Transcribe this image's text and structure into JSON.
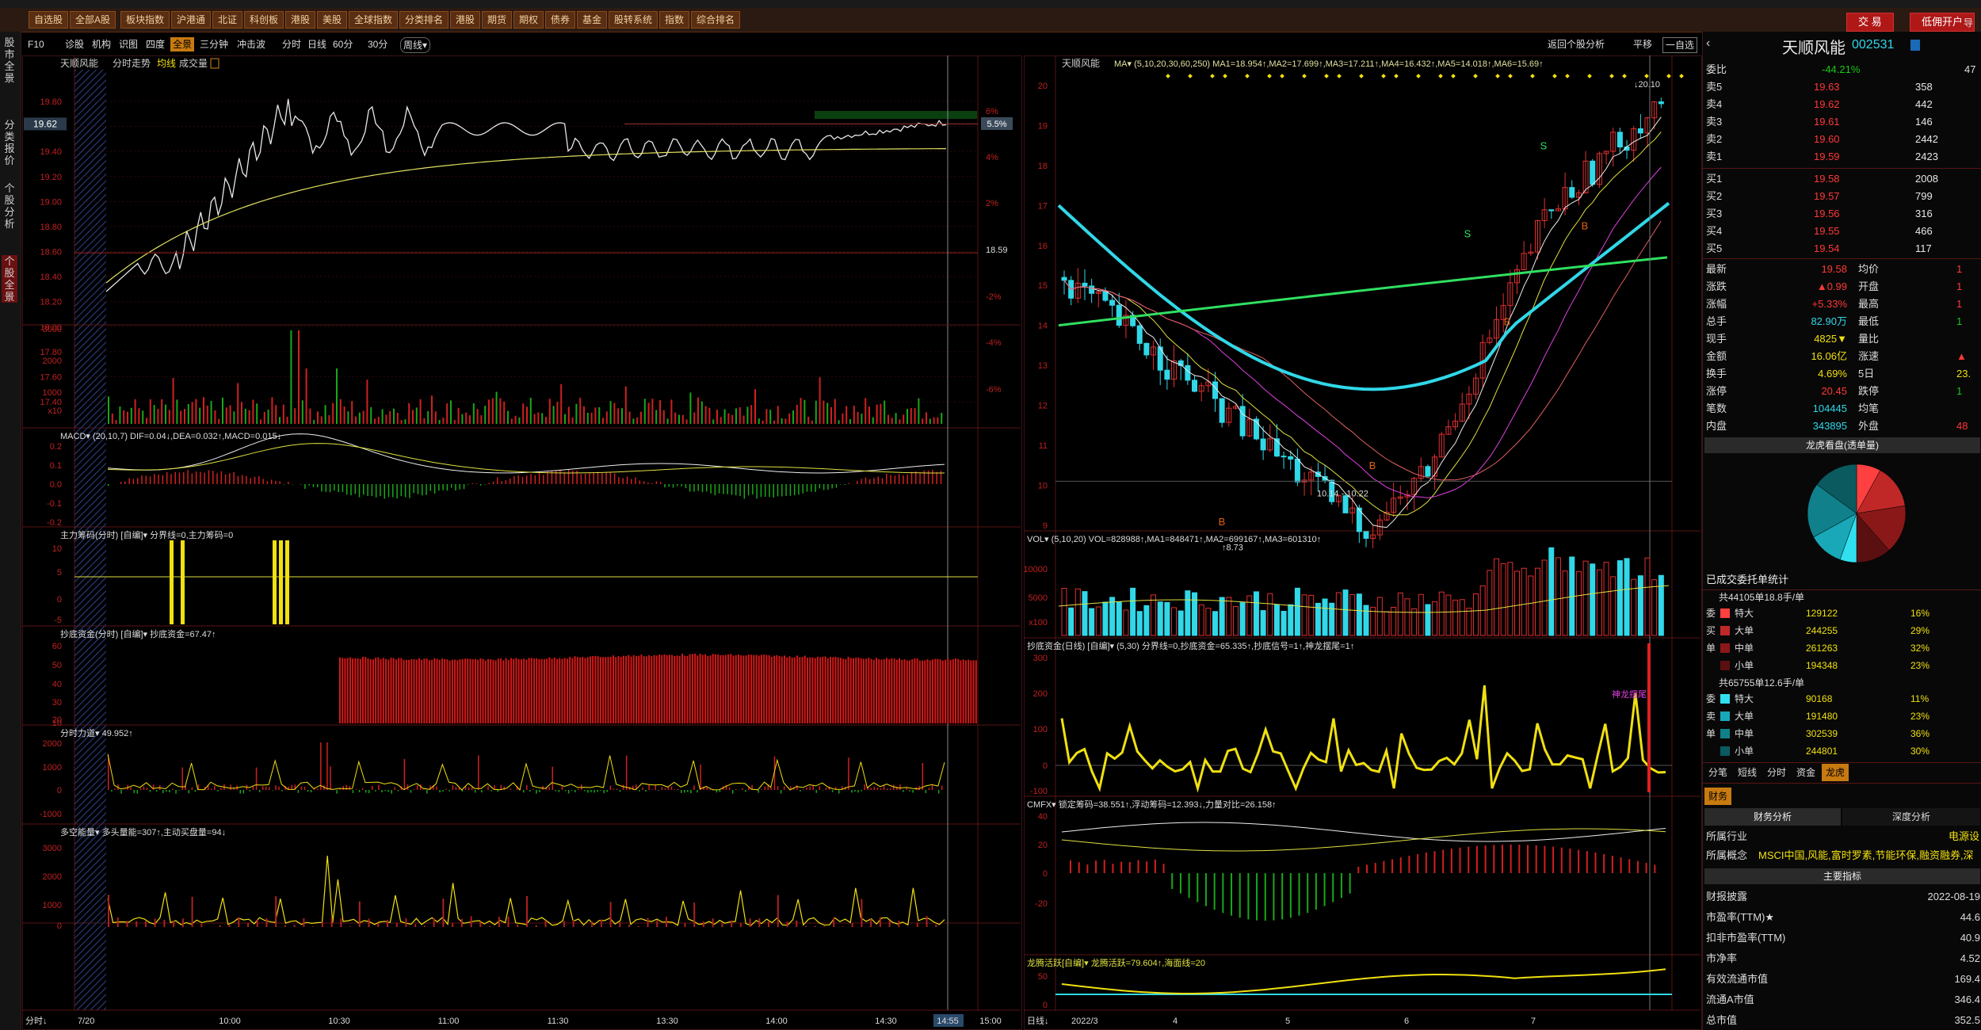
{
  "menu": {
    "buttons": [
      "自选股",
      "全部A股",
      "板块指数",
      "沪港通",
      "北证",
      "科创板",
      "港股",
      "美股",
      "全球指数",
      "分类排名",
      "港股",
      "期货",
      "期权",
      "债券",
      "基金",
      "股转系统",
      "指数",
      "综合排名"
    ],
    "trade": "交 易",
    "open_account": "低佣开户",
    "extra": "导航"
  },
  "leftrail": [
    "股市全景",
    "分类报价",
    "个股分析",
    "个股全景"
  ],
  "subbar": {
    "items": [
      "F10",
      "诊股",
      "机构",
      "识图",
      "四度",
      "全景",
      "三分钟",
      "冲击波"
    ],
    "active": "全景",
    "period": [
      "分时",
      "日线",
      "60分",
      "30分",
      "周线▾"
    ],
    "right": [
      "返回个股分析",
      "平移",
      "一自选"
    ]
  },
  "intraday": {
    "title": "天顺风能",
    "title2": "分时走势",
    "avg": "均线",
    "vol": "成交量",
    "price_ticks": [
      "19.80",
      "19.60",
      "19.40",
      "19.20",
      "19.00",
      "18.80",
      "18.60",
      "18.40",
      "18.20",
      "18.00",
      "17.80",
      "17.60",
      "17.40"
    ],
    "current_price": "19.62",
    "pct_ticks": [
      "6%",
      "4%",
      "2%",
      "18.59",
      "-2%",
      "-4%",
      "-6%"
    ],
    "pct_now": "5.5%",
    "vol_ticks": [
      "3000",
      "2000",
      "1000",
      "x10"
    ],
    "time_ticks": [
      "7/20",
      "10:00",
      "10:30",
      "11:00",
      "11:30",
      "13:30",
      "14:00",
      "14:30",
      "14:55",
      "15:00"
    ],
    "time_label": "分时",
    "macd_title": "MACD▾  (20,10,7)  DIF=0.04↓,DEA=0.032↑,MACD=0.015↓",
    "macd_ticks": [
      "0.2",
      "0.1",
      "0.0",
      "-0.1",
      "-0.2"
    ],
    "zl_title": "主力筹码(分时)  [自编]▾  分界线=0,主力筹码=0",
    "zl_ticks": [
      "10",
      "5",
      "0",
      "-5",
      "-10"
    ],
    "cd_title": "抄底资金(分时)  [自编]▾  抄底资金=67.47↑",
    "cd_ticks": [
      "60",
      "50",
      "40",
      "30",
      "20",
      "10"
    ],
    "fl_title": "分时力道▾  49.952↑",
    "fl_ticks": [
      "2000",
      "1000",
      "0",
      "-1000"
    ],
    "dk_title": "多空能量▾  多头量能=307↑,主动买盘量=94↓",
    "dk_ticks": [
      "3000",
      "2000",
      "1000",
      "0"
    ]
  },
  "daily": {
    "title": "天顺风能",
    "ma_label": "MA▾  (5,10,20,30,60,250)  MA1=18.954↑,MA2=17.699↑,MA3=17.211↑,MA4=16.432↑,MA5=14.018↑,MA6=15.69↑",
    "price_ticks": [
      "20",
      "19",
      "18",
      "17",
      "16",
      "15",
      "14",
      "13",
      "12",
      "11",
      "10",
      "9"
    ],
    "low_label": "8.73",
    "high_label": "20.10",
    "mid_label": "10.14 - 10.22",
    "vol_title": "VOL▾  (5,10,20)  VOL=828988↑,MA1=848471↑,MA2=699167↑,MA3=601310↑",
    "vol_ticks": [
      "10000",
      "5000",
      "x100"
    ],
    "cd_title": "抄底资金(日线)  [自编]▾  (5,30) 分界线=0,抄底资金=65.335↑,抄底信号=1↑,神龙摆尾=1↑",
    "cd_ticks": [
      "300",
      "200",
      "100",
      "0",
      "-100"
    ],
    "cd_tag": "神龙摆尾",
    "cmfx_title": "CMFX▾  锁定筹码=38.551↑,浮动筹码=12.393↓,力量对比=26.158↑",
    "cmfx_ticks": [
      "40",
      "20",
      "0",
      "-20"
    ],
    "lt_title": "龙腾活跃[自编]▾  龙腾活跃=79.604↑,海面线=20",
    "lt_ticks": [
      "50",
      "0"
    ],
    "date_ticks": [
      "2022/3",
      "4",
      "5",
      "6",
      "7"
    ],
    "date_label": "日线"
  },
  "quote": {
    "name": "天顺风能",
    "code": "002531",
    "webi": [
      "委比",
      "-44.21%",
      "47"
    ],
    "asks": [
      [
        "卖5",
        "19.63",
        "358"
      ],
      [
        "卖4",
        "19.62",
        "442"
      ],
      [
        "卖3",
        "19.61",
        "146"
      ],
      [
        "卖2",
        "19.60",
        "2442"
      ],
      [
        "卖1",
        "19.59",
        "2423"
      ]
    ],
    "bids": [
      [
        "买1",
        "19.58",
        "2008"
      ],
      [
        "买2",
        "19.57",
        "799"
      ],
      [
        "买3",
        "19.56",
        "316"
      ],
      [
        "买4",
        "19.55",
        "466"
      ],
      [
        "买5",
        "19.54",
        "117"
      ]
    ],
    "stats": [
      [
        "最新",
        "19.58",
        "均价",
        "1"
      ],
      [
        "涨跌",
        "▲0.99",
        "开盘",
        "1"
      ],
      [
        "涨幅",
        "+5.33%",
        "最高",
        "1"
      ],
      [
        "总手",
        "82.90万",
        "最低",
        "1"
      ],
      [
        "现手",
        "4825▼",
        "量比",
        ""
      ],
      [
        "金额",
        "16.06亿",
        "涨速",
        "▲"
      ],
      [
        "换手",
        "4.69%",
        "5日",
        "23."
      ],
      [
        "涨停",
        "20.45",
        "跌停",
        "1"
      ],
      [
        "笔数",
        "104445",
        "均笔",
        ""
      ],
      [
        "内盘",
        "343895",
        "外盘",
        "48"
      ]
    ],
    "dragon_title": "龙虎看盘(透单量)",
    "pie": {
      "slices": [
        {
          "value": 16,
          "color": "#ff4040"
        },
        {
          "value": 29,
          "color": "#c02828"
        },
        {
          "value": 32,
          "color": "#8a1818"
        },
        {
          "value": 23,
          "color": "#5a1010"
        },
        {
          "value": 11,
          "color": "#30e0f0"
        },
        {
          "value": 23,
          "color": "#18a8b8"
        },
        {
          "value": 36,
          "color": "#10808a"
        },
        {
          "value": 30,
          "color": "#0a5a60"
        }
      ]
    },
    "orders_title": "已成交委托单统计",
    "buy_total": "共44105单18.8手/单",
    "buy_side": [
      "委",
      "买",
      "单"
    ],
    "buy_rows": [
      [
        "特大",
        "129122",
        "16%",
        "#ff4040"
      ],
      [
        "大单",
        "244255",
        "29%",
        "#c02828"
      ],
      [
        "中单",
        "261263",
        "32%",
        "#8a1818"
      ],
      [
        "小单",
        "194348",
        "23%",
        "#5a1010"
      ]
    ],
    "sell_total": "共65755单12.6手/单",
    "sell_side": [
      "委",
      "卖",
      "单"
    ],
    "sell_rows": [
      [
        "特大",
        "90168",
        "11%",
        "#30e0f0"
      ],
      [
        "大单",
        "191480",
        "23%",
        "#18a8b8"
      ],
      [
        "中单",
        "302539",
        "36%",
        "#10808a"
      ],
      [
        "小单",
        "244801",
        "30%",
        "#0a5a60"
      ]
    ],
    "tabs": [
      "分笔",
      "短线",
      "分时",
      "资金",
      "龙虎"
    ],
    "tab_active": "龙虎",
    "fin_tab": "财务",
    "fin_sub": [
      "财务分析",
      "深度分析"
    ],
    "industry": [
      "所属行业",
      "电源设"
    ],
    "concept": [
      "所属概念",
      "MSCI中国,风能,富时罗素,节能环保,融资融券,深"
    ],
    "main_index": "主要指标",
    "fin_rows": [
      [
        "财报披露",
        "2022-08-19"
      ],
      [
        "市盈率(TTM)★",
        "44.6"
      ],
      [
        "扣非市盈率(TTM)",
        "40.9"
      ],
      [
        "市净率",
        "4.52"
      ],
      [
        "有效流通市值",
        "169.4"
      ],
      [
        "流通A市值",
        "346.4"
      ],
      [
        "总市值",
        "352.5"
      ]
    ]
  }
}
